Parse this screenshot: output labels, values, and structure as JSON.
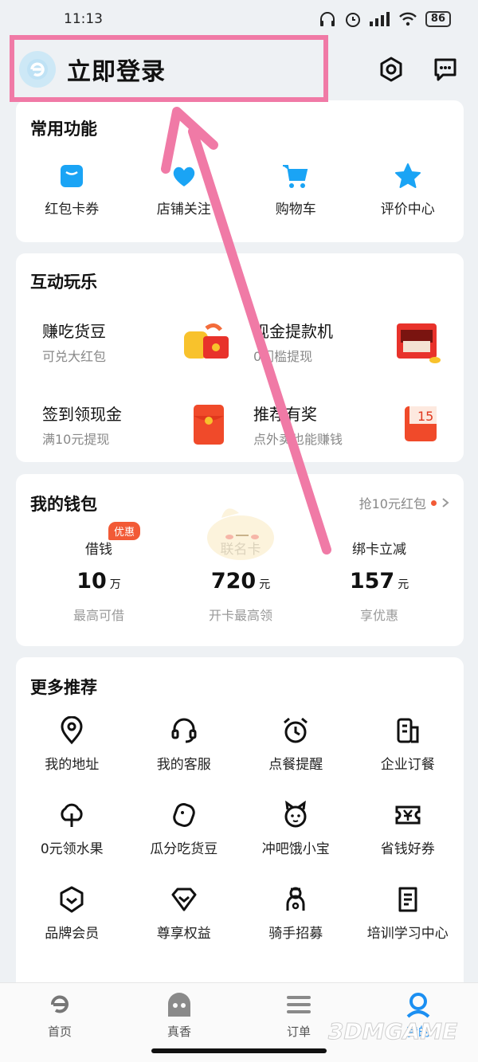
{
  "status_bar": {
    "time": "11:13",
    "battery": "86"
  },
  "header": {
    "login_label": "立即登录"
  },
  "common": {
    "title": "常用功能",
    "items": [
      {
        "label": "红包卡券",
        "icon": "coupon-icon"
      },
      {
        "label": "店铺关注",
        "icon": "heart-icon"
      },
      {
        "label": "购物车",
        "icon": "cart-icon"
      },
      {
        "label": "评价中心",
        "icon": "star-icon"
      }
    ]
  },
  "play": {
    "title": "互动玩乐",
    "items": [
      {
        "title": "赚吃货豆",
        "sub": "可兑大红包"
      },
      {
        "title": "现金提款机",
        "sub": "0门槛提现"
      },
      {
        "title": "签到领现金",
        "sub": "满10元提现"
      },
      {
        "title": "推荐有奖",
        "sub": "点外卖也能赚钱"
      }
    ]
  },
  "wallet": {
    "title": "我的钱包",
    "promo": "抢10元红包",
    "badge": "优惠",
    "items": [
      {
        "label": "借钱",
        "value": "10",
        "unit": "万",
        "sub": "最高可借"
      },
      {
        "label": "联名卡",
        "value": "720",
        "unit": "元",
        "sub": "开卡最高领"
      },
      {
        "label": "绑卡立减",
        "value": "157",
        "unit": "元",
        "sub": "享优惠"
      }
    ]
  },
  "more": {
    "title": "更多推荐",
    "items": [
      {
        "label": "我的地址"
      },
      {
        "label": "我的客服"
      },
      {
        "label": "点餐提醒"
      },
      {
        "label": "企业订餐"
      },
      {
        "label": "0元领水果"
      },
      {
        "label": "瓜分吃货豆"
      },
      {
        "label": "冲吧饿小宝"
      },
      {
        "label": "省钱好券"
      },
      {
        "label": "品牌会员"
      },
      {
        "label": "尊享权益"
      },
      {
        "label": "骑手招募"
      },
      {
        "label": "培训学习中心"
      }
    ]
  },
  "tabs": [
    {
      "label": "首页"
    },
    {
      "label": "真香"
    },
    {
      "label": "订单"
    },
    {
      "label": "我的"
    }
  ],
  "watermark": "3DMGAME",
  "colors": {
    "accent": "#1b8ff2",
    "highlight": "#f07aa6",
    "red": "#f25a36"
  }
}
